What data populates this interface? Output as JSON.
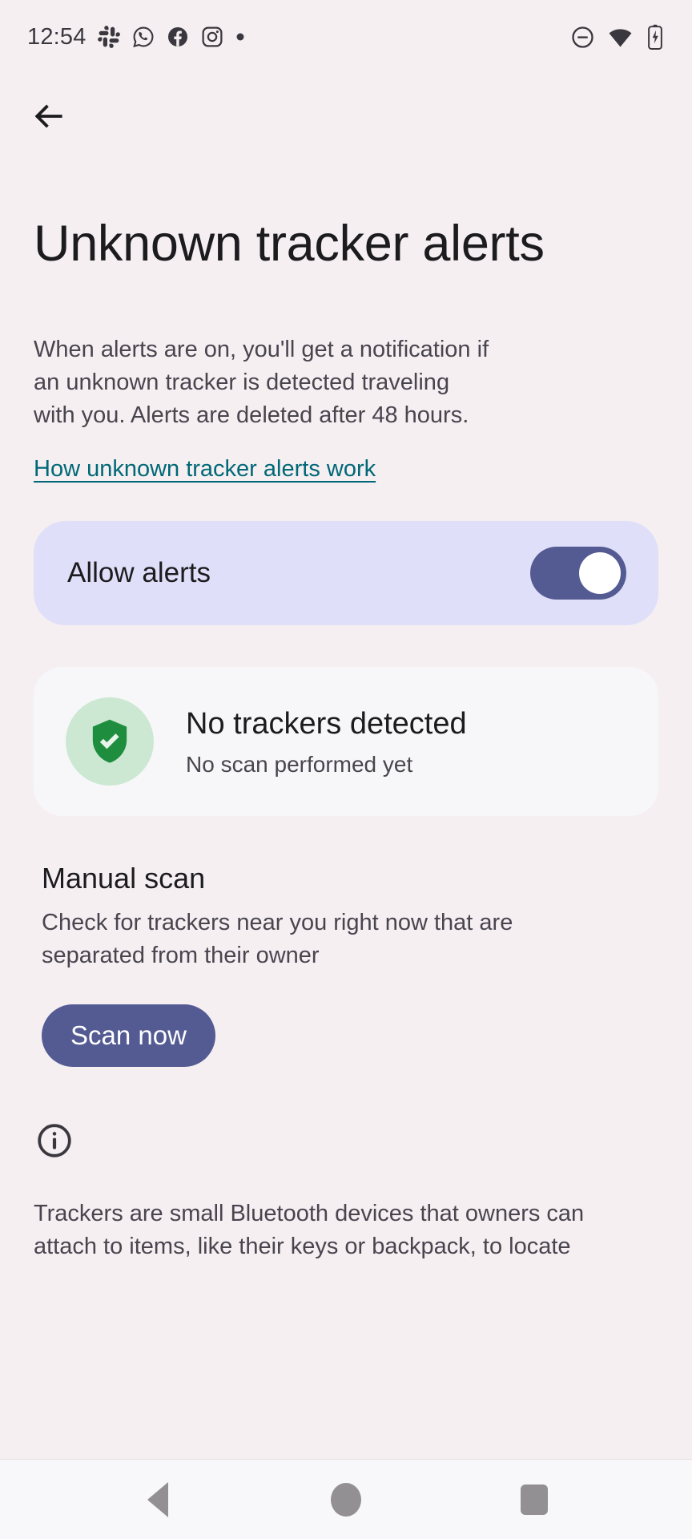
{
  "status_bar": {
    "time": "12:54",
    "left_icons": [
      "slack-icon",
      "whatsapp-icon",
      "facebook-icon",
      "instagram-icon",
      "notification-dot-icon"
    ],
    "right_icons": [
      "do-not-disturb-icon",
      "wifi-icon",
      "battery-charging-icon"
    ]
  },
  "app_bar": {
    "back_icon": "back-arrow-icon"
  },
  "page": {
    "title": "Unknown tracker alerts",
    "intro": "When alerts are on, you'll get a notification if an unknown tracker is detected traveling with you. Alerts are deleted after 48 hours.",
    "help_link": "How unknown tracker alerts work"
  },
  "allow_alerts": {
    "label": "Allow alerts",
    "enabled": true,
    "track_color": "#545B93",
    "card_color": "#DFDFF9"
  },
  "scan_status": {
    "icon": "shield-check-icon",
    "title": "No trackers detected",
    "subtitle": "No scan performed yet",
    "icon_color": "#1E8E3E",
    "icon_bg_color": "#CCE8D3",
    "card_color": "#F7F7FA"
  },
  "manual_scan": {
    "title": "Manual scan",
    "description": "Check for trackers near you right now that are separated from their owner",
    "button_label": "Scan now",
    "button_color": "#545B93"
  },
  "footer": {
    "icon": "info-icon",
    "text": "Trackers are small Bluetooth devices that owners can attach to items, like their keys or backpack, to locate"
  },
  "nav_bar": {
    "back_label": "Back",
    "home_label": "Home",
    "recents_label": "Recent apps"
  },
  "colors": {
    "page_background": "#F5EFF2",
    "link": "#006876",
    "primary_text": "#1C1B1E",
    "secondary_text": "#49454E",
    "nav_icon": "#939094"
  }
}
